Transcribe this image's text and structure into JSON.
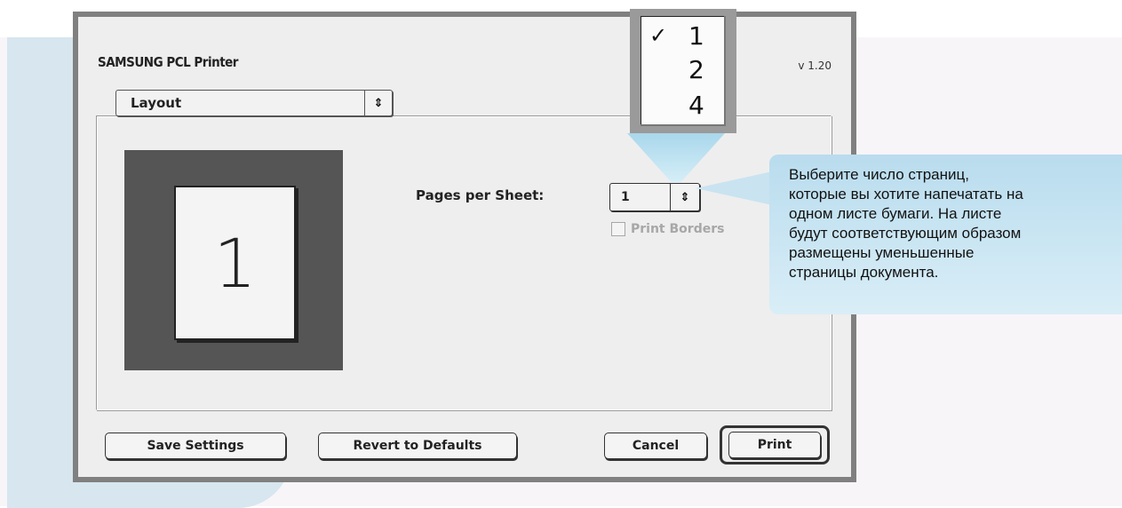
{
  "dialog": {
    "title": "SAMSUNG PCL Printer",
    "version": "v 1.20",
    "panel_popup": "Layout",
    "panel_popup_arrow": "⇕"
  },
  "layout": {
    "preview_page_number": "1",
    "pages_per_sheet_label": "Pages per Sheet:",
    "pages_per_sheet_value": "1",
    "pages_per_sheet_arrow": "⇕",
    "print_borders_label": "Print Borders"
  },
  "buttons": {
    "save": "Save Settings",
    "revert": "Revert to Defaults",
    "cancel": "Cancel",
    "print": "Print"
  },
  "zoom_menu": {
    "items": [
      {
        "label": "1",
        "checked": true,
        "check_glyph": "✓"
      },
      {
        "label": "2",
        "checked": false,
        "check_glyph": ""
      },
      {
        "label": "4",
        "checked": false,
        "check_glyph": ""
      }
    ]
  },
  "callout": {
    "text": "Выберите число страниц,\nкоторые вы хотите напечатать на\nодном листе бумаги. На листе\nбудут соответствующим образом\nразмещены уменьшенные\nстраницы документа."
  },
  "colors": {
    "dialog_frame": "#808080",
    "dialog_bg": "#eeeeee",
    "callout_bg": "#c9e3f1",
    "disabled_text": "#a7a7a7"
  }
}
